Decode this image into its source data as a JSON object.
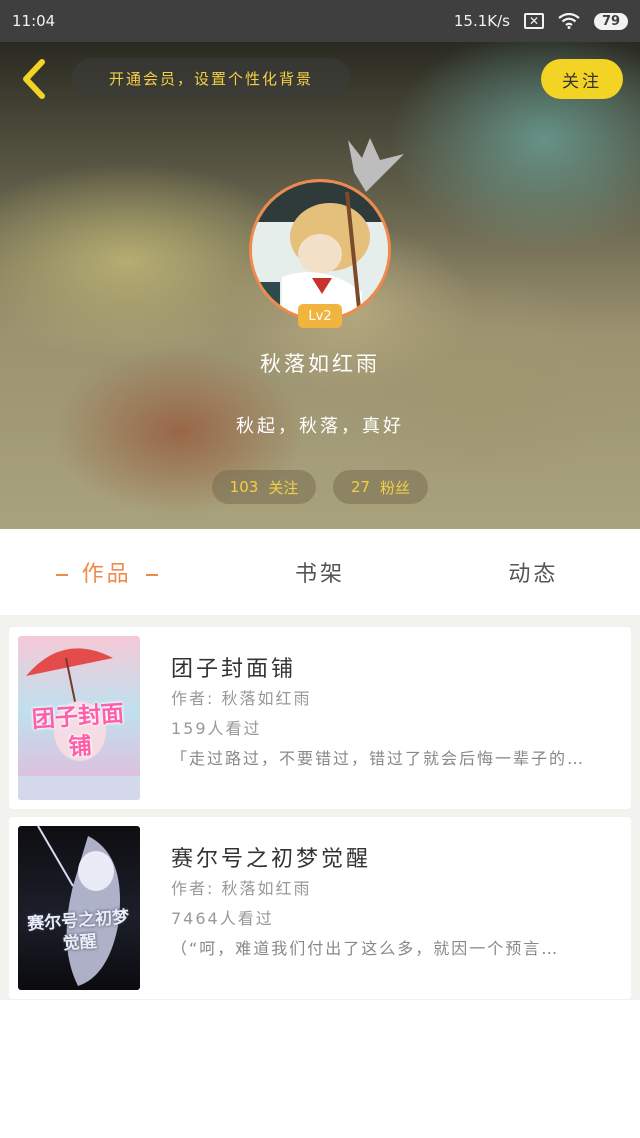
{
  "status_bar": {
    "time": "11:04",
    "network_speed": "15.1K/s",
    "battery": "79"
  },
  "header": {
    "vip_banner": "开通会员，设置个性化背景",
    "follow_label": "关注"
  },
  "profile": {
    "level": "Lv2",
    "nickname": "秋落如红雨",
    "signature": "秋起，秋落，真好",
    "following_count": "103",
    "following_label": "关注",
    "fans_count": "27",
    "fans_label": "粉丝"
  },
  "tabs": [
    {
      "label": "作品",
      "active": true
    },
    {
      "label": "书架",
      "active": false
    },
    {
      "label": "动态",
      "active": false
    }
  ],
  "works": [
    {
      "title": "团子封面铺",
      "author": "作者: 秋落如红雨",
      "views": "159人看过",
      "excerpt": "「走过路过，不要错过，错过了就会后悔一辈子的…",
      "cover_text": "团子封面铺"
    },
    {
      "title": "赛尔号之初梦觉醒",
      "author": "作者: 秋落如红雨",
      "views": "7464人看过",
      "excerpt": "（“呵，难道我们付出了这么多，就因一个预言…",
      "cover_text": "赛尔号之初梦觉醒"
    }
  ],
  "colors": {
    "accent": "#f08a4b",
    "follow_button": "#f3d323",
    "banner_text": "#f3d046"
  },
  "icons": [
    "back-chevron-icon",
    "crown-icon",
    "wifi-icon",
    "close-box-icon",
    "battery-icon"
  ]
}
